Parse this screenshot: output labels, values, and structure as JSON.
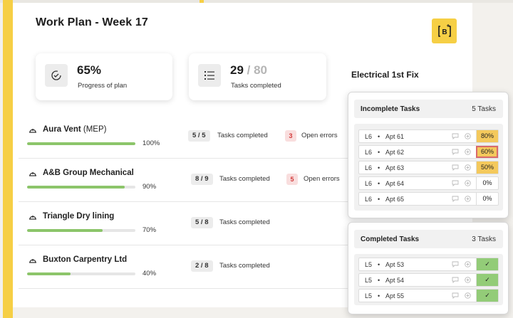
{
  "header": {
    "title": "Work Plan - Week 17"
  },
  "stats": {
    "progress": {
      "value": "65%",
      "label": "Progress of plan",
      "icon": "progress-check-icon"
    },
    "tasks": {
      "value": "29",
      "total": "/ 80",
      "label": "Tasks completed",
      "icon": "list-icon"
    }
  },
  "section_title": "Electrical 1st Fix",
  "companies": [
    {
      "name": "Aura Vent",
      "suffix": "(MEP)",
      "progress": 1.0,
      "pct": "100%",
      "badge": "5 / 5",
      "badge_label": "Tasks completed",
      "errors": "3",
      "errors_label": "Open errors"
    },
    {
      "name": "A&B Group Mechanical",
      "suffix": "",
      "progress": 0.9,
      "pct": "90%",
      "badge": "8 / 9",
      "badge_label": "Tasks completed",
      "errors": "5",
      "errors_label": "Open errors"
    },
    {
      "name": "Triangle Dry lining",
      "suffix": "",
      "progress": 0.7,
      "pct": "70%",
      "badge": "5 / 8",
      "badge_label": "Tasks completed"
    },
    {
      "name": "Buxton Carpentry Ltd",
      "suffix": "",
      "progress": 0.4,
      "pct": "40%",
      "badge": "2 / 8",
      "badge_label": "Tasks completed"
    }
  ],
  "incomplete": {
    "title": "Incomplete Tasks",
    "count": "5 Tasks",
    "tasks": [
      {
        "level": "L6",
        "apt": "Apt 61",
        "value": "80%",
        "state": "yellow"
      },
      {
        "level": "L6",
        "apt": "Apt 62",
        "value": "60%",
        "state": "yellow-red"
      },
      {
        "level": "L6",
        "apt": "Apt 63",
        "value": "50%",
        "state": "yellow"
      },
      {
        "level": "L6",
        "apt": "Apt 64",
        "value": "0%",
        "state": "none"
      },
      {
        "level": "L6",
        "apt": "Apt 65",
        "value": "0%",
        "state": "none"
      }
    ]
  },
  "completed": {
    "title": "Completed Tasks",
    "count": "3 Tasks",
    "tasks": [
      {
        "level": "L5",
        "apt": "Apt 53",
        "value": "✓",
        "state": "green"
      },
      {
        "level": "L5",
        "apt": "Apt 54",
        "value": "✓",
        "state": "green"
      },
      {
        "level": "L5",
        "apt": "Apt 55",
        "value": "✓",
        "state": "green"
      }
    ]
  },
  "colors": {
    "accent": "#f6cf45",
    "progress": "#8cc56a",
    "warning": "#f4c95c",
    "success": "#93cc78",
    "error": "#d23b3b"
  }
}
